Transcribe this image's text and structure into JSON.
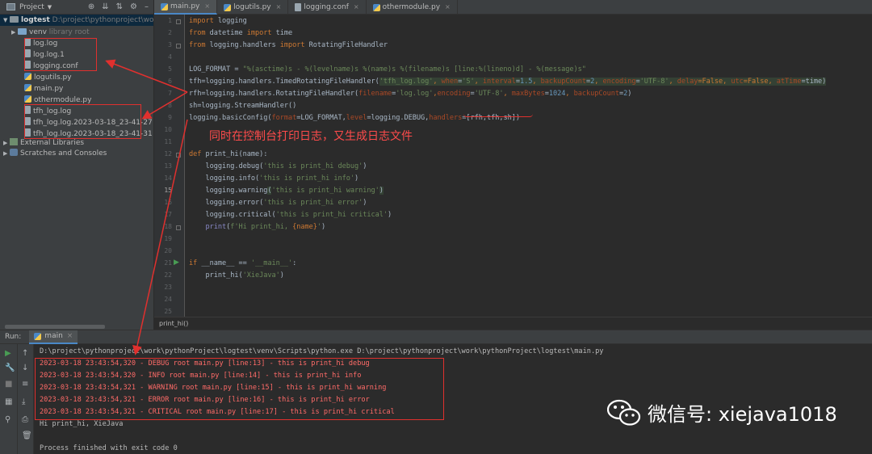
{
  "project_panel": {
    "title": "Project",
    "tree": [
      {
        "label": "logtest",
        "path": "D:\\project\\pythonproject\\work\\",
        "kind": "root"
      },
      {
        "label": "venv",
        "suffix": "library root",
        "kind": "folder"
      },
      {
        "label": "log.log",
        "kind": "file"
      },
      {
        "label": "log.log.1",
        "kind": "file"
      },
      {
        "label": "logging.conf",
        "kind": "file"
      },
      {
        "label": "logutils.py",
        "kind": "py"
      },
      {
        "label": "main.py",
        "kind": "py"
      },
      {
        "label": "othermodule.py",
        "kind": "py"
      },
      {
        "label": "tfh_log.log",
        "kind": "file"
      },
      {
        "label": "tfh_log.log.2023-03-18_23-41-27",
        "kind": "file"
      },
      {
        "label": "tfh_log.log.2023-03-18_23-41-31",
        "kind": "file"
      },
      {
        "label": "External Libraries",
        "kind": "lib"
      },
      {
        "label": "Scratches and Consoles",
        "kind": "scratch"
      }
    ]
  },
  "editor": {
    "tabs": [
      "main.py",
      "logutils.py",
      "logging.conf",
      "othermodule.py"
    ],
    "active_tab": "main.py",
    "line_numbers": [
      "1",
      "2",
      "3",
      "4",
      "5",
      "6",
      "7",
      "8",
      "9",
      "10",
      "11",
      "12",
      "13",
      "14",
      "15",
      "16",
      "17",
      "18",
      "19",
      "20",
      "21",
      "22",
      "23",
      "24",
      "25"
    ],
    "current_line": "15",
    "code": {
      "l1a": "import",
      "l1b": " logging",
      "l2a": "from",
      "l2b": " datetime ",
      "l2c": "import",
      "l2d": " time",
      "l3a": "from",
      "l3b": " logging.handlers ",
      "l3c": "import",
      "l3d": " RotatingFileHandler",
      "l5a": "LOG_FORMAT = ",
      "l5b": "\"%(asctime)s - %(levelname)s %(name)s %(filename)s [line:%(lineno)d] - %(message)s\"",
      "l6": "tfh=logging.handlers.TimedRotatingFileHandler(",
      "l6b": "'tfh_log.log'",
      "l6c": ", ",
      "l6d": "when",
      "l6e": "=",
      "l6f": "'S'",
      "l6g": ", ",
      "l6h": "interval",
      "l6i": "=",
      "l6j": "1.5",
      "l6k": ", ",
      "l6l": "backupCount",
      "l6m": "=",
      "l6n": "2",
      "l6o": ", ",
      "l6p": "encoding",
      "l6q": "=",
      "l6r": "'UTF-8'",
      "l6s": ", ",
      "l6t": "delay",
      "l6u": "=False, ",
      "l6v": "utc",
      "l6w": "=False, ",
      "l6x": "atTime",
      "l6y": "=time)",
      "l7": "rfh=logging.handlers.RotatingFileHandler(",
      "l7b": "filename",
      "l7c": "=",
      "l7d": "'log.log'",
      "l7e": ",",
      "l7f": "encoding",
      "l7g": "=",
      "l7h": "'UTF-8'",
      "l7i": ", ",
      "l7j": "maxBytes",
      "l7k": "=",
      "l7l": "1024",
      "l7m": ", ",
      "l7n": "backupCount",
      "l7o": "=",
      "l7p": "2",
      "l7q": ")",
      "l8": "sh=logging.StreamHandler()",
      "l9a": "logging.basicConfig(",
      "l9b": "format",
      "l9c": "=LOG_FORMAT,",
      "l9d": "level",
      "l9e": "=logging.DEBUG,",
      "l9f": "handlers",
      "l9g": "=[rfh,tfh,sh])",
      "l12a": "def",
      "l12b": " print_hi(name):",
      "l13a": "    logging.debug(",
      "l13b": "'this is print_hi debug'",
      "l13c": ")",
      "l14a": "    logging.info(",
      "l14b": "'this is print_hi info'",
      "l14c": ")",
      "l15a": "    logging.warning",
      "l15p": "(",
      "l15b": "'this is print_hi warning'",
      "l15c": ")",
      "l16a": "    logging.error(",
      "l16b": "'this is print_hi error'",
      "l16c": ")",
      "l17a": "    logging.critical(",
      "l17b": "'this is print_hi critical'",
      "l17c": ")",
      "l18a": "    ",
      "l18b": "print",
      "l18c": "(",
      "l18d": "f'Hi print_hi, ",
      "l18e": "{name}",
      "l18f": "'",
      "l18g": ")",
      "l21a": "if",
      "l21b": " __name__ == ",
      "l21c": "'__main__'",
      "l21d": ":",
      "l22a": "    print_hi(",
      "l22b": "'XieJava'",
      "l22c": ")"
    },
    "breadcrumb": "print_hi()",
    "annotation": "同时在控制台打印日志，又生成日志文件"
  },
  "run_panel": {
    "label": "Run:",
    "tab": "main",
    "lines": [
      {
        "text": "D:\\project\\pythonproject\\work\\pythonProject\\logtest\\venv\\Scripts\\python.exe D:\\project\\pythonproject\\work\\pythonProject\\logtest\\main.py",
        "type": "normal"
      },
      {
        "text": "2023-03-18 23:43:54,320 - DEBUG root main.py [line:13] - this is print_hi debug",
        "type": "err"
      },
      {
        "text": "2023-03-18 23:43:54,320 - INFO root main.py [line:14] - this is print_hi info",
        "type": "err"
      },
      {
        "text": "2023-03-18 23:43:54,321 - WARNING root main.py [line:15] - this is print_hi warning",
        "type": "err"
      },
      {
        "text": "2023-03-18 23:43:54,321 - ERROR root main.py [line:16] - this is print_hi error",
        "type": "err"
      },
      {
        "text": "2023-03-18 23:43:54,321 - CRITICAL root main.py [line:17] - this is print_hi critical",
        "type": "err"
      },
      {
        "text": "Hi print_hi, XieJava",
        "type": "normal"
      },
      {
        "text": "",
        "type": "normal"
      },
      {
        "text": "Process finished with exit code 0",
        "type": "normal"
      }
    ]
  },
  "watermark": {
    "text": "微信号: xiejava1018"
  },
  "colors": {
    "keyword": "#cc7832",
    "string": "#6a8759",
    "number": "#6897bb",
    "param": "#aa4926",
    "console_error": "#ff6b68",
    "annotation": "#ff4b4b"
  }
}
